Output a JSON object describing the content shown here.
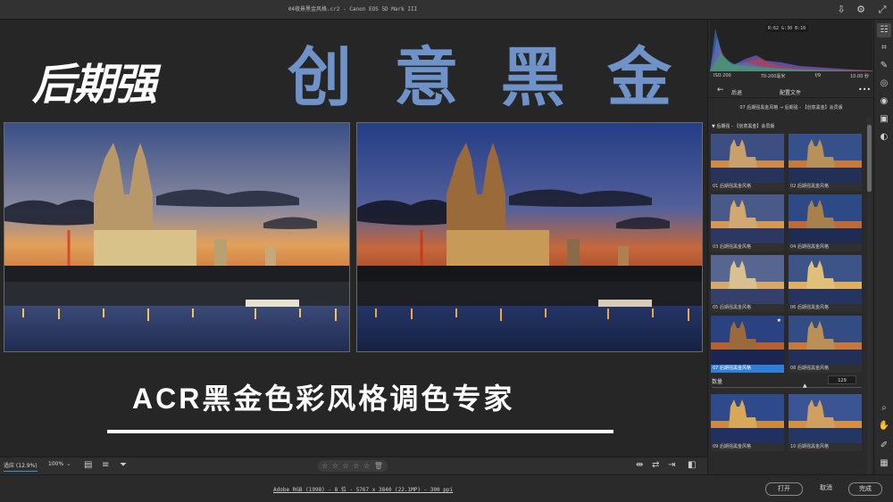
{
  "window": {
    "title": "04夜景黑金风格.cr2 - Canon EOS 5D Mark III"
  },
  "titlebar_icons": [
    "export-icon",
    "gear-icon",
    "expand-icon"
  ],
  "canvas": {
    "logo_text": "后期强",
    "big_title": [
      "创",
      "意",
      "黑",
      "金"
    ],
    "subtitle": "ACR黑金色彩风格调色专家"
  },
  "bottom_toolbar": {
    "zoom_fit": "适应 (12.9%)",
    "zoom_level": "100%",
    "stars": "☆ ☆ ☆ ☆ ☆  🗑"
  },
  "status_bar": {
    "file_info": "Adobe RGB (1998) - 8 位 - 5767 x 3840 (22.1MP) - 300 ppi",
    "open_button": "打开",
    "cancel_button": "取消",
    "done_button": "完成"
  },
  "right_panel": {
    "histogram_values": "R:62  G:30  B:10",
    "camera_info": {
      "iso": "ISO 200",
      "lens": "70-200毫米",
      "aperture": "f/9",
      "shutter": "10.00 秒"
    },
    "nav": {
      "back_label": "后退",
      "title": "配置文件"
    },
    "breadcrumb": "07 后期强黑金风格 → 后期强 - 【创意黑金】会员版",
    "group_header": "▼ 后期强 - 【创意黑金】会员版",
    "presets": [
      {
        "label": "01 后期强黑金风格",
        "selected": false
      },
      {
        "label": "02 后期强黑金风格",
        "selected": false
      },
      {
        "label": "03 后期强黑金风格",
        "selected": false
      },
      {
        "label": "04 后期强黑金风格",
        "selected": false
      },
      {
        "label": "05 后期强黑金风格",
        "selected": false
      },
      {
        "label": "06 后期强黑金风格",
        "selected": false
      },
      {
        "label": "07 后期强黑金风格",
        "selected": true
      },
      {
        "label": "08 后期强黑金风格",
        "selected": false
      },
      {
        "label": "09 后期强黑金风格",
        "selected": false
      },
      {
        "label": "10 后期强黑金风格",
        "selected": false
      }
    ],
    "amount_label": "数量",
    "amount_value": "129"
  },
  "colors": {
    "accent": "#2f7fd9",
    "title_blue": "#6f92c9"
  }
}
